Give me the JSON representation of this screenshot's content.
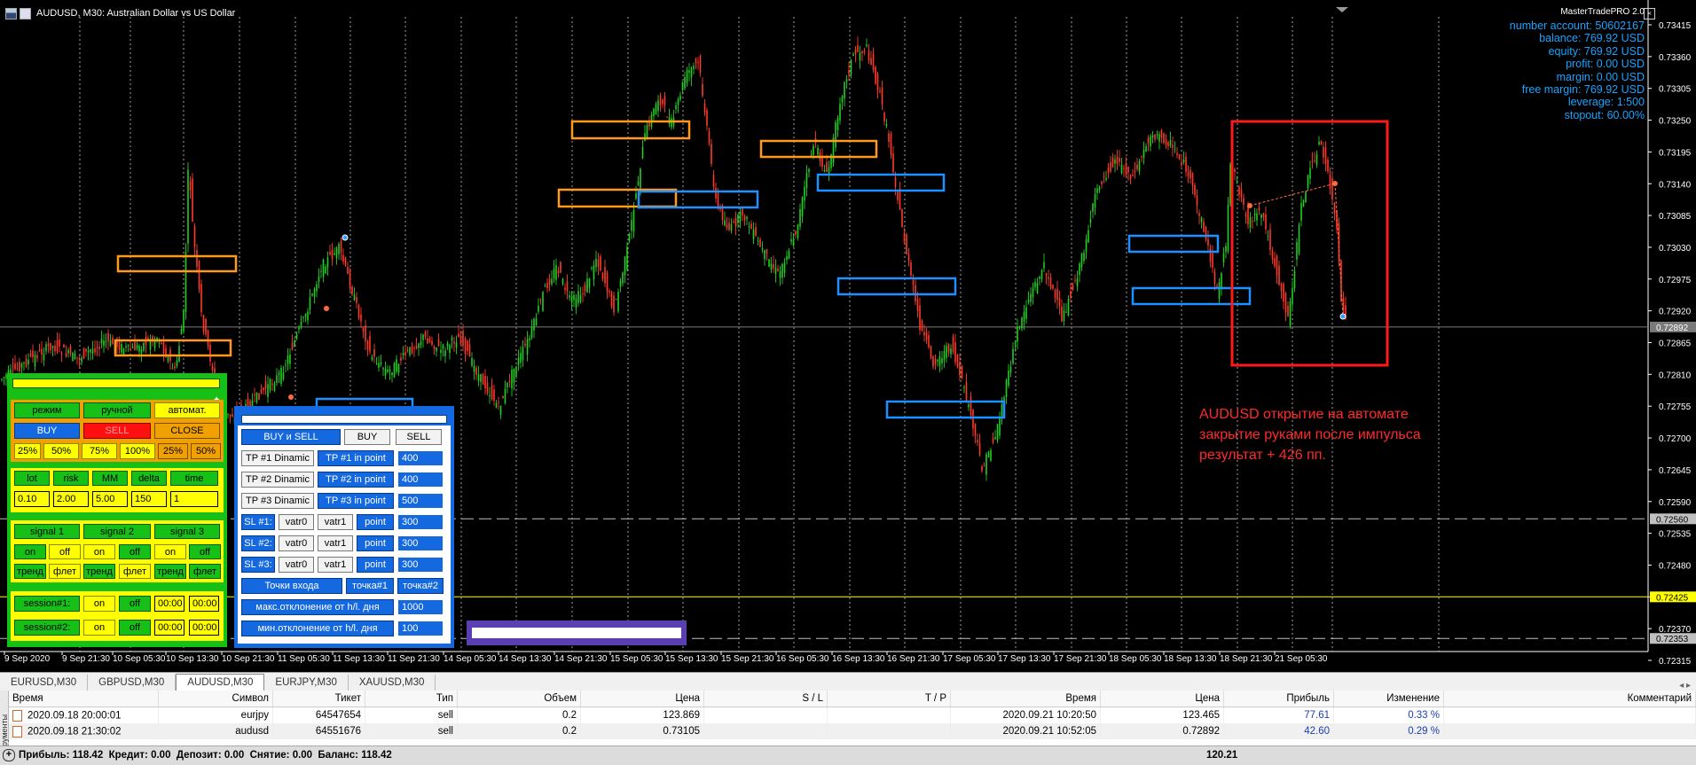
{
  "window": {
    "title": "AUDUSD, M30:  Australian Dollar vs US Dollar"
  },
  "account": {
    "ea_name": "MasterTradePRO 2.0",
    "lines": [
      "number account: 50602167",
      "balance: 769.92 USD",
      "equity: 769.92 USD",
      "profit: 0.00 USD",
      "margin: 0.00 USD",
      "free margin: 769.92 USD",
      "leverage: 1:500",
      "stopout: 60.00%"
    ]
  },
  "price_axis": {
    "ticks": [
      "0.73415",
      "0.73360",
      "0.73305",
      "0.73250",
      "0.73195",
      "0.73140",
      "0.73085",
      "0.73030",
      "0.72975",
      "0.72920",
      "0.72865",
      "0.72810",
      "0.72755",
      "0.72700",
      "0.72645",
      "0.72590",
      "0.72535",
      "0.72480",
      "0.72425",
      "0.72370",
      "0.72315"
    ],
    "label_current": "0.72892",
    "label_dashed": "0.72560",
    "label_yellow": "0.72425",
    "label_dashed2": "0.72353",
    "colors": {
      "current": "#7a7a7a",
      "yellow": "#ffff00",
      "dashed": "#c0c0c0"
    }
  },
  "time_axis": [
    "9 Sep 2020",
    "9 Sep 21:30",
    "10 Sep 05:30",
    "10 Sep 13:30",
    "10 Sep 21:30",
    "11 Sep 05:30",
    "11 Sep 13:30",
    "11 Sep 21:30",
    "14 Sep 05:30",
    "14 Sep 13:30",
    "14 Sep 21:30",
    "15 Sep 05:30",
    "15 Sep 13:30",
    "15 Sep 21:30",
    "16 Sep 05:30",
    "16 Sep 13:30",
    "16 Sep 21:30",
    "17 Sep 05:30",
    "17 Sep 13:30",
    "17 Sep 21:30",
    "18 Sep 05:30",
    "18 Sep 13:30",
    "18 Sep 21:30",
    "21 Sep 05:30"
  ],
  "annotation": {
    "lines": [
      "AUDUSD открытие на автомате",
      "закрытие руками после импульса",
      "результат + 426 пп."
    ],
    "color": "#ff2a2a"
  },
  "panel_left": {
    "mode": [
      "режим",
      "ручной",
      "автомат."
    ],
    "actions": [
      "BUY",
      "SELL",
      "CLOSE"
    ],
    "pcts": [
      "25%",
      "50%",
      "75%",
      "100%",
      "25%",
      "50%"
    ],
    "params_labels": [
      "lot",
      "risk",
      "MM",
      "delta",
      "time"
    ],
    "params_values": [
      "0.10",
      "2.00",
      "5.00",
      "150",
      "1"
    ],
    "signals": [
      "signal 1",
      "signal 2",
      "signal 3"
    ],
    "onoff": [
      "on",
      "off",
      "on",
      "off",
      "on",
      "off"
    ],
    "trend": [
      "тренд",
      "флет",
      "тренд",
      "флет",
      "тренд",
      "флет"
    ],
    "session1": {
      "label": "session#1:",
      "on": "on",
      "off": "off",
      "t1": "00:00",
      "t2": "00:00"
    },
    "session2": {
      "label": "session#2:",
      "on": "on",
      "off": "off",
      "t1": "00:00",
      "t2": "00:00"
    }
  },
  "panel_right": {
    "row1": [
      "BUY и SELL",
      "BUY",
      "SELL"
    ],
    "tp": [
      {
        "a": "TP #1 Dinamic",
        "b": "TP #1 in point",
        "v": "400"
      },
      {
        "a": "TP #2 Dinamic",
        "b": "TP #2 in point",
        "v": "400"
      },
      {
        "a": "TP #3 Dinamic",
        "b": "TP #3 in point",
        "v": "500"
      }
    ],
    "sl": [
      {
        "l": "SL #1:",
        "a": "vatr0",
        "b": "vatr1",
        "c": "point",
        "v": "300"
      },
      {
        "l": "SL #2:",
        "a": "vatr0",
        "b": "vatr1",
        "c": "point",
        "v": "300"
      },
      {
        "l": "SL #3:",
        "a": "vatr0",
        "b": "vatr1",
        "c": "point",
        "v": "300"
      }
    ],
    "entry": [
      "Точки входа",
      "точка#1",
      "точка#2"
    ],
    "max_dev": {
      "label": "макс.отклонение от h/l. дня",
      "v": "1000"
    },
    "min_dev": {
      "label": "мин.отклонение от h/l. дня",
      "v": "100"
    }
  },
  "tabs": [
    "EURUSD,M30",
    "GBPUSD,M30",
    "AUDUSD,M30",
    "EURJPY,M30",
    "XAUUSD,M30"
  ],
  "active_tab": 2,
  "terminal": {
    "headers": [
      "Время",
      "Символ",
      "Тикет",
      "Тип",
      "Объем",
      "Цена",
      "S / L",
      "T / P",
      "Время",
      "Цена",
      "Прибыль",
      "Изменение",
      "Комментарий"
    ],
    "rows": [
      [
        "2020.09.18 20:00:01",
        "eurjpy",
        "64547654",
        "sell",
        "0.2",
        "123.869",
        "",
        "",
        "2020.09.21 10:20:50",
        "123.465",
        "77.61",
        "0.33 %",
        ""
      ],
      [
        "2020.09.18 21:30:02",
        "audusd",
        "64551676",
        "sell",
        "0.2",
        "0.73105",
        "",
        "",
        "2020.09.21 10:52:05",
        "0.72892",
        "42.60",
        "0.29 %",
        ""
      ]
    ],
    "summary": "Прибыль: 118.42  Кредит: 0.00  Депозит: 0.00  Снятие: 0.00  Баланс: 118.42",
    "total": "120.21",
    "side_label": "Инструменты"
  }
}
